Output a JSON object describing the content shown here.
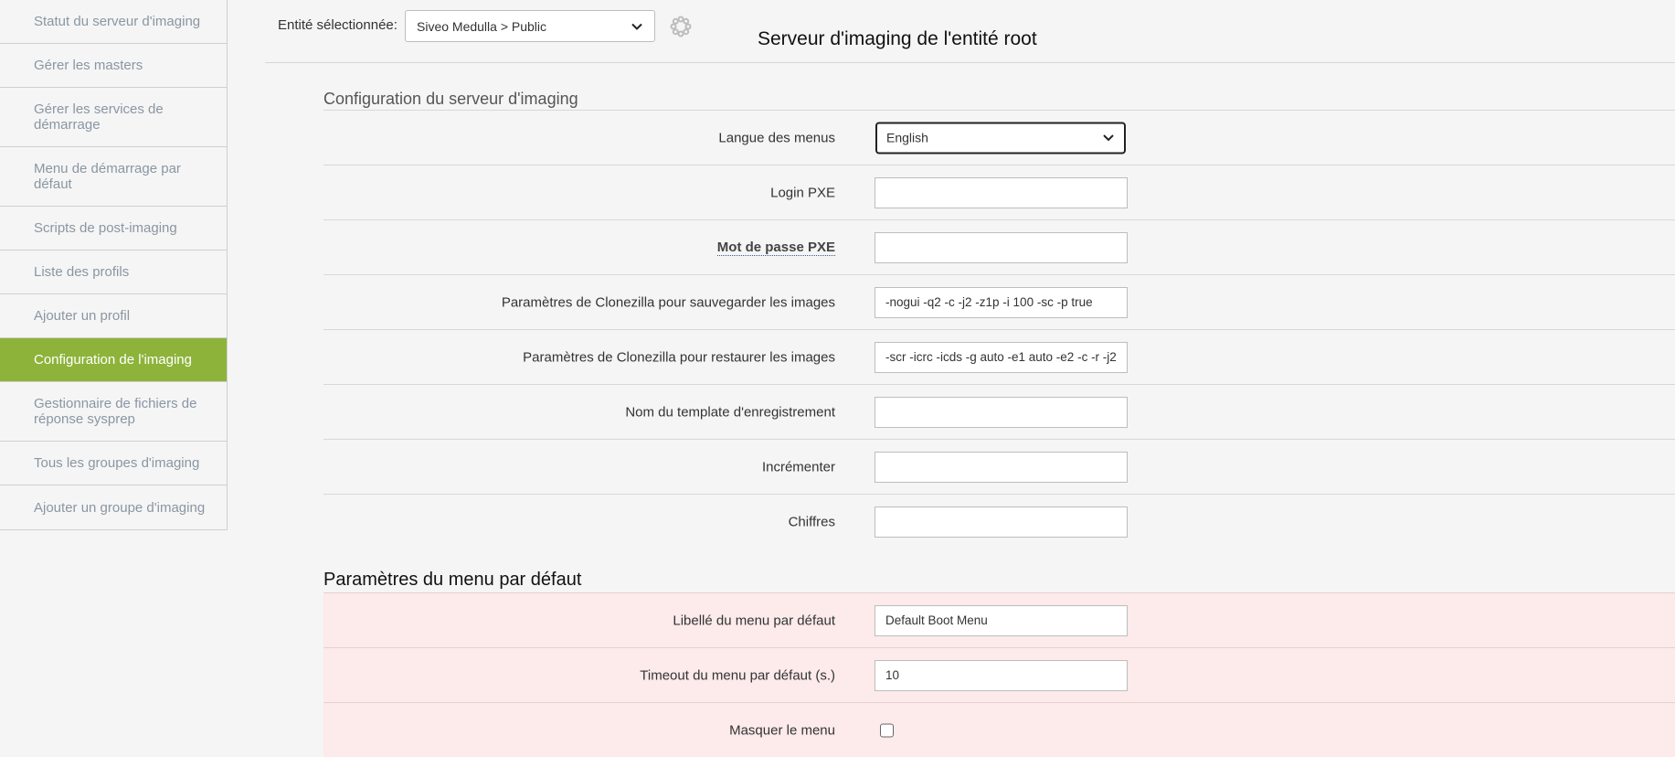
{
  "sidebar": {
    "items": [
      {
        "label": "Statut du serveur d'imaging"
      },
      {
        "label": "Gérer les masters"
      },
      {
        "label": "Gérer les services de démarrage"
      },
      {
        "label": "Menu de démarrage par défaut"
      },
      {
        "label": "Scripts de post-imaging"
      },
      {
        "label": "Liste des profils"
      },
      {
        "label": "Ajouter un profil"
      },
      {
        "label": "Configuration de l'imaging"
      },
      {
        "label": "Gestionnaire de fichiers de réponse sysprep"
      },
      {
        "label": "Tous les groupes d'imaging"
      },
      {
        "label": "Ajouter un groupe d'imaging"
      }
    ],
    "active_item": "Configuration de l'imaging",
    "active_color": "#8db33a"
  },
  "header": {
    "entity_label": "Entité sélectionnée:",
    "entity_value": "Siveo Medulla > Public",
    "title": "Serveur d'imaging de l'entité root",
    "loading_icon": "spinner-icon"
  },
  "config_section": {
    "title": "Configuration du serveur d'imaging",
    "fields": [
      {
        "label": "Langue des menus",
        "value": "English"
      },
      {
        "label": "Login PXE",
        "value": ""
      },
      {
        "label": "Mot de passe PXE",
        "value": ""
      },
      {
        "label": "Paramètres de Clonezilla pour sauvegarder les images",
        "value": "-nogui -q2 -c -j2 -z1p -i 100 -sc -p true"
      },
      {
        "label": "Paramètres de Clonezilla pour restaurer les images",
        "value": "-scr -icrc -icds -g auto -e1 auto -e2 -c -r -j2"
      },
      {
        "label": "Nom du template d'enregistrement",
        "value": ""
      },
      {
        "label": "Incrémenter",
        "value": ""
      },
      {
        "label": "Chiffres",
        "value": ""
      }
    ]
  },
  "menu_section": {
    "title": "Paramètres du menu par défaut",
    "background_color": "#fdeaea",
    "fields": [
      {
        "label": "Libellé du menu par défaut",
        "value": "Default Boot Menu"
      },
      {
        "label": "Timeout du menu par défaut (s.)",
        "value": "10"
      },
      {
        "label": "Masquer le menu",
        "checked": false
      }
    ]
  }
}
